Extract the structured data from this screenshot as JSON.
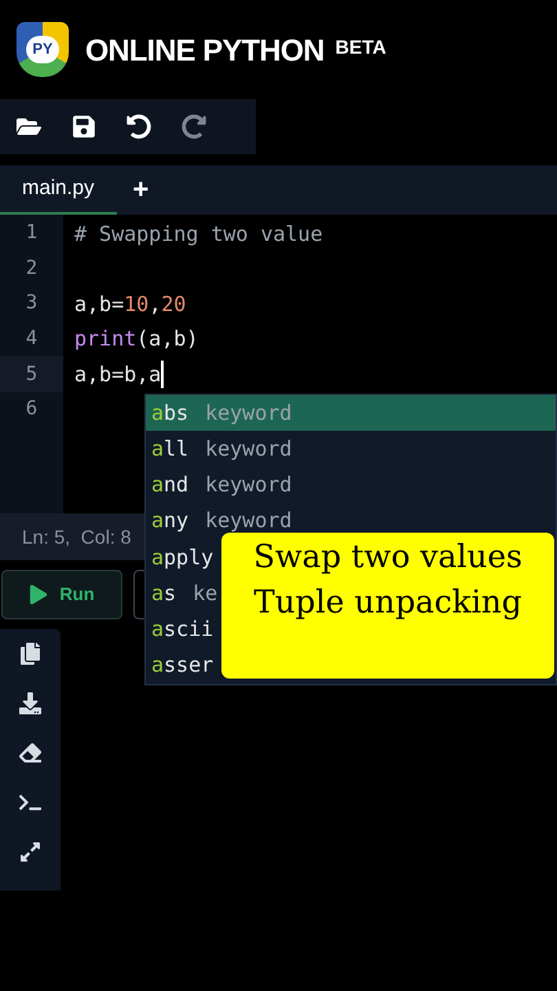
{
  "header": {
    "logo_text": "PY",
    "title": "ONLINE PYTHON",
    "badge": "BETA"
  },
  "toolbar": [
    {
      "kind": "open",
      "disabled": false
    },
    {
      "kind": "save",
      "disabled": false
    },
    {
      "kind": "undo",
      "disabled": false
    },
    {
      "kind": "redo",
      "disabled": true
    }
  ],
  "tabs": [
    {
      "label": "main.py",
      "selected": true
    }
  ],
  "add_tab": "+",
  "editor": {
    "lines": [
      {
        "number": "1",
        "tokens": [
          {
            "kind": "comment",
            "text": "# Swapping two value"
          }
        ]
      },
      {
        "number": "2"
      },
      {
        "number": "3",
        "tokens": [
          {
            "kind": "plain",
            "text": "a,b="
          },
          {
            "kind": "number",
            "text": "10"
          },
          {
            "kind": "plain",
            "text": ","
          },
          {
            "kind": "number",
            "text": "20"
          }
        ]
      },
      {
        "number": "4",
        "tokens": [
          {
            "kind": "builtin",
            "text": "print"
          },
          {
            "kind": "plain",
            "text": "(a,b)"
          }
        ]
      },
      {
        "number": "5",
        "tokens": [
          {
            "kind": "plain",
            "text": "a,b=b,a"
          }
        ],
        "cursor": true
      },
      {
        "number": "6"
      }
    ]
  },
  "autocomplete": [
    {
      "match": "a",
      "rest": "bs",
      "detail": "keyword",
      "selected": true
    },
    {
      "match": "a",
      "rest": "ll",
      "detail": "keyword",
      "selected": false
    },
    {
      "match": "a",
      "rest": "nd",
      "detail": "keyword",
      "selected": false
    },
    {
      "match": "a",
      "rest": "ny",
      "detail": "keyword",
      "selected": false
    },
    {
      "match": "a",
      "rest": "pply",
      "selected": false
    },
    {
      "match": "a",
      "rest": "s",
      "detail": "ke",
      "selected": false
    },
    {
      "match": "a",
      "rest": "scii",
      "selected": false
    },
    {
      "match": "a",
      "rest": "sser",
      "selected": false
    }
  ],
  "status_bar": "Ln: 5,  Col: 8",
  "run_button": "Run",
  "side_tools": [
    {
      "kind": "copy"
    },
    {
      "kind": "download"
    },
    {
      "kind": "erase"
    },
    {
      "kind": "terminal"
    },
    {
      "kind": "expand"
    }
  ],
  "caption": [
    "Swap two values",
    "Tuple unpacking"
  ]
}
